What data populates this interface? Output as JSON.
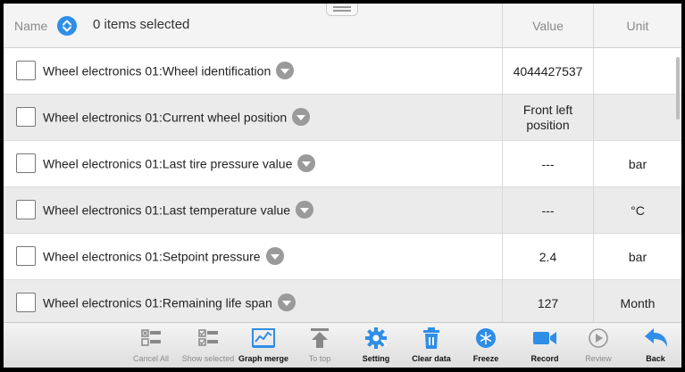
{
  "header": {
    "name_label": "Name",
    "selected_text": "0 items selected",
    "value_label": "Value",
    "unit_label": "Unit"
  },
  "rows": [
    {
      "name": "Wheel electronics 01:Wheel identification",
      "value": "4044427537",
      "unit": ""
    },
    {
      "name": "Wheel electronics 01:Current wheel position",
      "value": "Front left position",
      "unit": ""
    },
    {
      "name": "Wheel electronics 01:Last tire pressure value",
      "value": "---",
      "unit": "bar"
    },
    {
      "name": "Wheel electronics 01:Last temperature value",
      "value": "---",
      "unit": "°C"
    },
    {
      "name": "Wheel electronics 01:Setpoint pressure",
      "value": "2.4",
      "unit": "bar"
    },
    {
      "name": "Wheel electronics 01:Remaining life span",
      "value": "127",
      "unit": "Month"
    }
  ],
  "toolbar": {
    "cancel_all": "Cancel All",
    "show_selected": "Show selected",
    "graph_merge": "Graph merge",
    "to_top": "To top",
    "setting": "Setting",
    "clear_data": "Clear data",
    "freeze": "Freeze",
    "record": "Record",
    "review": "Review",
    "back": "Back"
  },
  "icons": {
    "sort": "sort-icon",
    "row_detail": "chevron-down-icon",
    "cancel_all": "list-cancel-icon",
    "show_selected": "list-check-icon",
    "graph_merge": "chart-icon",
    "to_top": "arrow-up-bar-icon",
    "setting": "gear-icon",
    "clear_data": "trash-icon",
    "freeze": "snowflake-icon",
    "record": "video-camera-icon",
    "review": "play-icon",
    "back": "back-arrow-icon"
  },
  "colors": {
    "accent": "#2f8ee6",
    "disabled": "#9a9a9a",
    "row_alt": "#ebebeb"
  }
}
